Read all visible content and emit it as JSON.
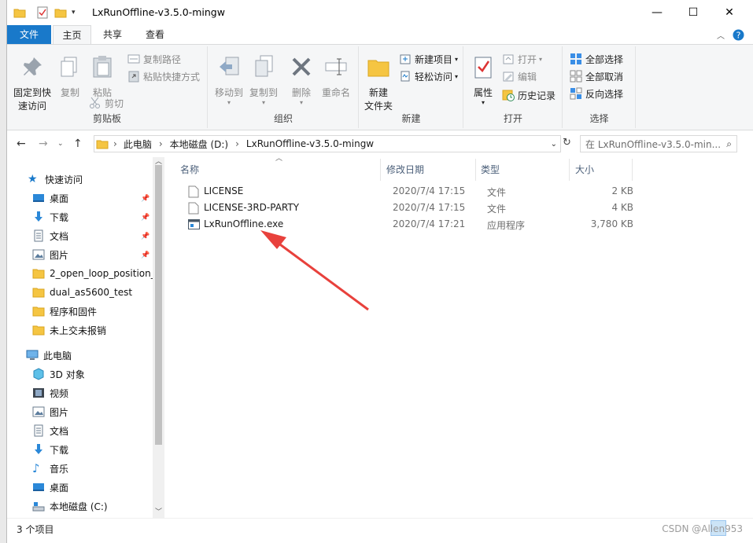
{
  "window": {
    "title": "LxRunOffline-v3.5.0-mingw",
    "minimize_label": "—",
    "maximize_label": "☐",
    "close_label": "✕"
  },
  "ribbon_tabs": {
    "file": "文件",
    "home": "主页",
    "share": "共享",
    "view": "查看"
  },
  "ribbon": {
    "clipboard": {
      "label": "剪贴板",
      "pin": "固定到快\n速访问",
      "copy": "复制",
      "paste": "粘贴",
      "copy_path": "复制路径",
      "paste_shortcut": "粘贴快捷方式",
      "cut": "剪切"
    },
    "organize": {
      "label": "组织",
      "move_to": "移动到",
      "copy_to": "复制到",
      "delete": "删除",
      "rename": "重命名"
    },
    "new": {
      "label": "新建",
      "new_folder": "新建\n文件夹",
      "new_item": "新建项目",
      "easy_access": "轻松访问"
    },
    "open": {
      "label": "打开",
      "properties": "属性",
      "open": "打开",
      "edit": "编辑",
      "history": "历史记录"
    },
    "select": {
      "label": "选择",
      "select_all": "全部选择",
      "select_none": "全部取消",
      "invert": "反向选择"
    }
  },
  "address": {
    "crumbs": [
      "此电脑",
      "本地磁盘 (D:)",
      "LxRunOffline-v3.5.0-mingw"
    ],
    "search_placeholder": "在 LxRunOffline-v3.5.0-min..."
  },
  "nav": {
    "quick_access": "快速访问",
    "quick_items": [
      "桌面",
      "下载",
      "文档",
      "图片",
      "2_open_loop_position_",
      "dual_as5600_test",
      "程序和固件",
      "未上交未报销"
    ],
    "this_pc": "此电脑",
    "pc_items": [
      "3D 对象",
      "视频",
      "图片",
      "文档",
      "下载",
      "音乐",
      "桌面",
      "本地磁盘 (C:)"
    ]
  },
  "columns": {
    "name": "名称",
    "modified": "修改日期",
    "type": "类型",
    "size": "大小"
  },
  "files": [
    {
      "name": "LICENSE",
      "modified": "2020/7/4 17:15",
      "type": "文件",
      "size": "2 KB"
    },
    {
      "name": "LICENSE-3RD-PARTY",
      "modified": "2020/7/4 17:15",
      "type": "文件",
      "size": "4 KB"
    },
    {
      "name": "LxRunOffline.exe",
      "modified": "2020/7/4 17:21",
      "type": "应用程序",
      "size": "3,780 KB"
    }
  ],
  "status": {
    "count": "3 个项目",
    "watermark": "CSDN @Allen953"
  },
  "colors": {
    "accent": "#1979ca",
    "annotation_arrow": "#e8413c",
    "folder": "#f5c542"
  }
}
